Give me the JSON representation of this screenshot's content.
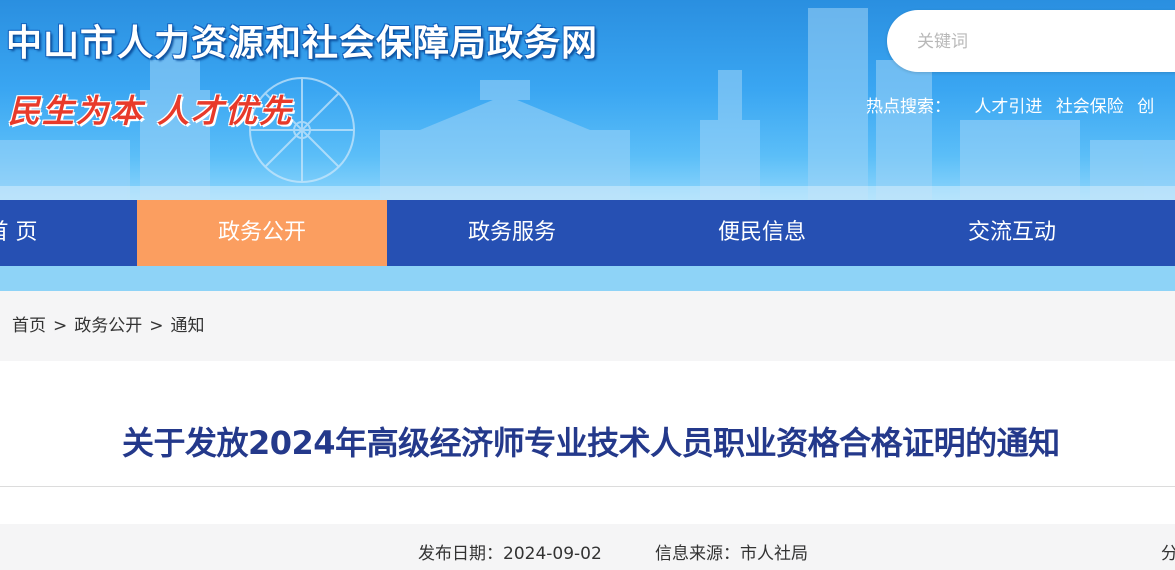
{
  "header": {
    "site_title": "中山市人力资源和社会保障局政务网",
    "slogan": "民生为本 人才优先",
    "search": {
      "placeholder": "关键词"
    },
    "hot_search": {
      "label": "热点搜索：",
      "links": [
        "人才引进",
        "社会保险",
        "创"
      ]
    }
  },
  "nav": {
    "items": [
      "首 页",
      "政务公开",
      "政务服务",
      "便民信息",
      "交流互动"
    ],
    "active_index": 1
  },
  "breadcrumb": {
    "items": [
      "首页",
      "政务公开",
      "通知"
    ],
    "separator": ">"
  },
  "article": {
    "title": "关于发放2024年高级经济师专业技术人员职业资格合格证明的通知",
    "meta": {
      "date": "发布日期：2024-09-02",
      "source": "信息来源：市人社局",
      "share": "分"
    }
  },
  "colors": {
    "nav_bg": "#2650b3",
    "nav_active": "#fb9e60",
    "nav_strip": "#8ed3f7",
    "title": "#24398b",
    "slogan": "#e83a2a"
  }
}
